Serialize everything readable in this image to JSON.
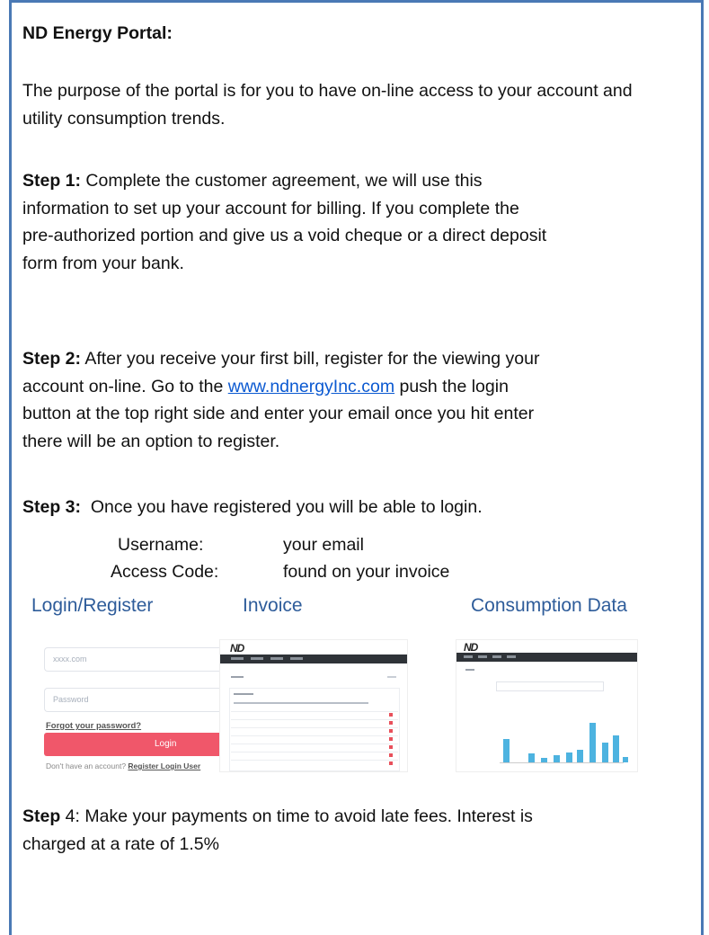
{
  "heading": "ND Energy Portal:",
  "purpose": "The purpose of the portal is for you to have on-line access to your account and utility consumption trends.",
  "step1": {
    "label": "Step 1:",
    "line1": " Complete the customer agreement, we will use this",
    "line2": "information to set up your account for billing.  If you complete the",
    "line3": "pre-authorized portion and give us a void cheque or a direct deposit",
    "line4": "form from your bank."
  },
  "step2": {
    "label": "Step 2:",
    "line1": " After you receive your first bill, register for the viewing your",
    "line2a": "account on-line.  Go to the ",
    "link": "www.ndnergyInc.com",
    "line2b": " push the login",
    "line3": "button at the top right side and enter your email once you hit enter",
    "line4": "there will be an option to register."
  },
  "step3": {
    "label": "Step 3:",
    "text": "  Once you have registered you will be able to login.",
    "username_label": "Username:",
    "username_value": "your email",
    "access_label": "Access Code:",
    "access_value": "found on your invoice"
  },
  "sections": {
    "login": "Login/Register",
    "invoice": "Invoice",
    "consumption": "Consumption Data"
  },
  "login_thumb": {
    "email_placeholder": "xxxx.com",
    "password_placeholder": "Password",
    "forgot": "Forgot your password?",
    "login_button": "Login",
    "no_account": "Don't have an account? ",
    "register_link": "Register Login User"
  },
  "logo": "ND",
  "step4": {
    "label": "Step",
    "line1": " 4:  Make your payments on time to avoid late fees.  Interest is",
    "line2": "charged at a rate of 1.5%"
  },
  "colors": {
    "frame": "#4a79b5",
    "section_title": "#2e5c9a",
    "link": "#0b59d1",
    "login_button": "#f0576a",
    "chart_bar": "#4db3e0"
  }
}
